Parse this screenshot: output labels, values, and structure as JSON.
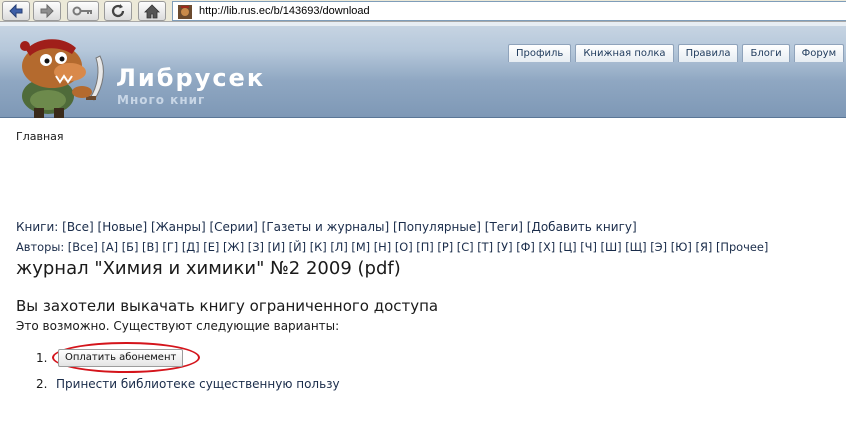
{
  "browser": {
    "url": "http://lib.rus.ec/b/143693/download",
    "buttons": [
      "back-icon",
      "forward-icon",
      "key-icon",
      "refresh-icon",
      "home-icon"
    ]
  },
  "site": {
    "title": "Либрусек",
    "slogan": "Много книг"
  },
  "tabs": [
    "Профиль",
    "Книжная полка",
    "Правила",
    "Блоги",
    "Форум"
  ],
  "breadcrumb": "Главная",
  "books_nav": {
    "label": "Книги:",
    "links": [
      "[Все]",
      "[Новые]",
      "[Жанры]",
      "[Серии]",
      "[Газеты и журналы]",
      "[Популярные]",
      "[Теги]",
      "[Добавить книгу]"
    ]
  },
  "authors_nav": {
    "label": "Авторы:",
    "links": [
      "[Все]",
      "[А]",
      "[Б]",
      "[В]",
      "[Г]",
      "[Д]",
      "[Е]",
      "[Ж]",
      "[З]",
      "[И]",
      "[Й]",
      "[К]",
      "[Л]",
      "[М]",
      "[Н]",
      "[О]",
      "[П]",
      "[Р]",
      "[С]",
      "[Т]",
      "[У]",
      "[Ф]",
      "[Х]",
      "[Ц]",
      "[Ч]",
      "[Ш]",
      "[Щ]",
      "[Э]",
      "[Ю]",
      "[Я]",
      "[Прочее]"
    ]
  },
  "page_title": "журнал \"Химия и химики\" №2 2009 (pdf)",
  "subheading": "Вы захотели выкачать книгу ограниченного доступа",
  "note": "Это возможно. Существуют следующие варианты:",
  "options": {
    "item1_number": "1.",
    "item1_button": "Оплатить абонемент",
    "item2_number": "2.",
    "item2_link": "Принести библиотеке существенную пользу"
  },
  "colors": {
    "header_blue": "#8fa7c2",
    "highlight_red": "#d4141b",
    "link_text": "#1a2c4a"
  }
}
